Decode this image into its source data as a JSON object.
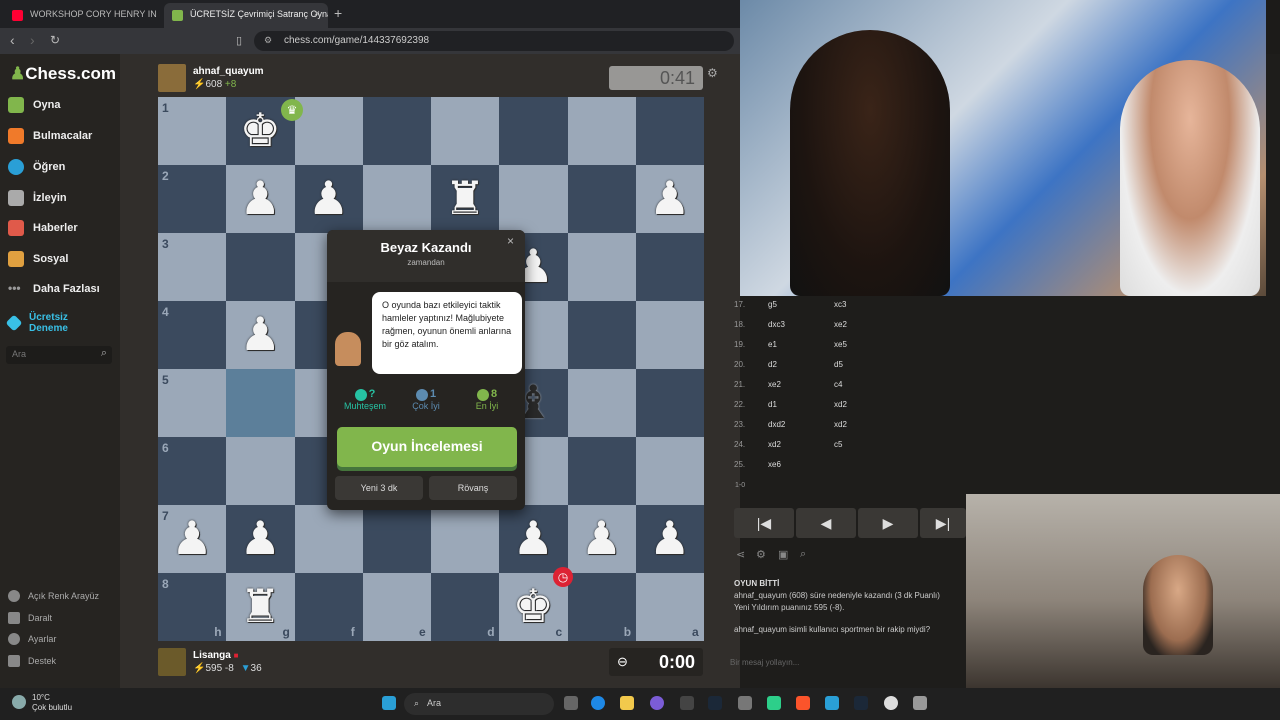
{
  "browser": {
    "tabs": [
      {
        "label": "WORKSHOP CORY HENRY IN RIO",
        "color": "#ff0033"
      },
      {
        "label": "ÜCRETSİZ Çevrimiçi Satranç Oyna",
        "color": "#81b64c"
      }
    ],
    "new_tab": "+",
    "url": "chess.com/game/144337692398"
  },
  "sidebar": {
    "logo_text": "Chess.com",
    "items": [
      {
        "label": "Oyna",
        "color": "#81b64c"
      },
      {
        "label": "Bulmacalar",
        "color": "#f07a2a"
      },
      {
        "label": "Öğren",
        "color": "#2a9fd6"
      },
      {
        "label": "İzleyin",
        "color": "#aaaaaa"
      },
      {
        "label": "Haberler",
        "color": "#e05a4a"
      },
      {
        "label": "Sosyal",
        "color": "#e0a040"
      },
      {
        "label": "Daha Fazlası",
        "color": "#999999"
      },
      {
        "label": "Ücretsiz Deneme",
        "color": "#39c0e6"
      }
    ],
    "search_placeholder": "Ara",
    "bottom": [
      {
        "label": "Açık Renk Arayüz"
      },
      {
        "label": "Daralt"
      },
      {
        "label": "Ayarlar"
      },
      {
        "label": "Destek"
      }
    ]
  },
  "top_player": {
    "name": "ahnaf_quayum",
    "rating": "608",
    "delta": "+8",
    "clock": "0:41"
  },
  "bottom_player": {
    "name": "Lisanga",
    "rating": "595",
    "delta": "-8",
    "extra": "36",
    "clock": "0:00"
  },
  "board": {
    "ranks": [
      "1",
      "2",
      "3",
      "4",
      "5",
      "6",
      "7",
      "8"
    ],
    "files": [
      "h",
      "g",
      "f",
      "e",
      "d",
      "c",
      "b",
      "a"
    ]
  },
  "modal": {
    "title": "Beyaz Kazandı",
    "subtitle": "zamandan",
    "close": "×",
    "coach_text": "O oyunda bazı etkileyici taktik hamleler yaptınız! Mağlubiyete rağmen, oyunun önemli anlarına bir göz atalım.",
    "stats": [
      {
        "count": "?",
        "label": "Muhteşem",
        "color": "#26c2a3"
      },
      {
        "count": "1",
        "label": "Çok İyi",
        "color": "#5c8bb0"
      },
      {
        "count": "8",
        "label": "En İyi",
        "color": "#81b64c"
      }
    ],
    "review_button": "Oyun İncelemesi",
    "new_game_button": "Yeni 3 dk",
    "rematch_button": "Rövanş"
  },
  "moves": [
    {
      "num": "17.",
      "white": "g5",
      "black": "xc3"
    },
    {
      "num": "18.",
      "white": "dxc3",
      "black": "xe2"
    },
    {
      "num": "19.",
      "white": "e1",
      "black": "xe5"
    },
    {
      "num": "20.",
      "white": "d2",
      "black": "d5"
    },
    {
      "num": "21.",
      "white": "xe2",
      "black": "c4"
    },
    {
      "num": "22.",
      "white": "d1",
      "black": "xd2"
    },
    {
      "num": "23.",
      "white": "dxd2",
      "black": "xd2"
    },
    {
      "num": "24.",
      "white": "xd2",
      "black": "c5"
    },
    {
      "num": "25.",
      "white": "xe6",
      "black": ""
    }
  ],
  "result": "1-0",
  "controls": [
    "|◀",
    "◀",
    "▶",
    "▶|"
  ],
  "chat": {
    "header": "OYUN BİTTİ",
    "line1": "ahnaf_quayum (608) süre nedeniyle kazandı (3 dk Puanlı)",
    "line2": "Yeni Yıldırım puanınız 595 (-8).",
    "line3": "ahnaf_quayum isimli kullanıcı sportmen bir rakip miydi?",
    "placeholder": "Bir mesaj yollayın..."
  },
  "taskbar": {
    "temp": "10°C",
    "weather": "Çok bulutlu",
    "search": "Ara"
  }
}
